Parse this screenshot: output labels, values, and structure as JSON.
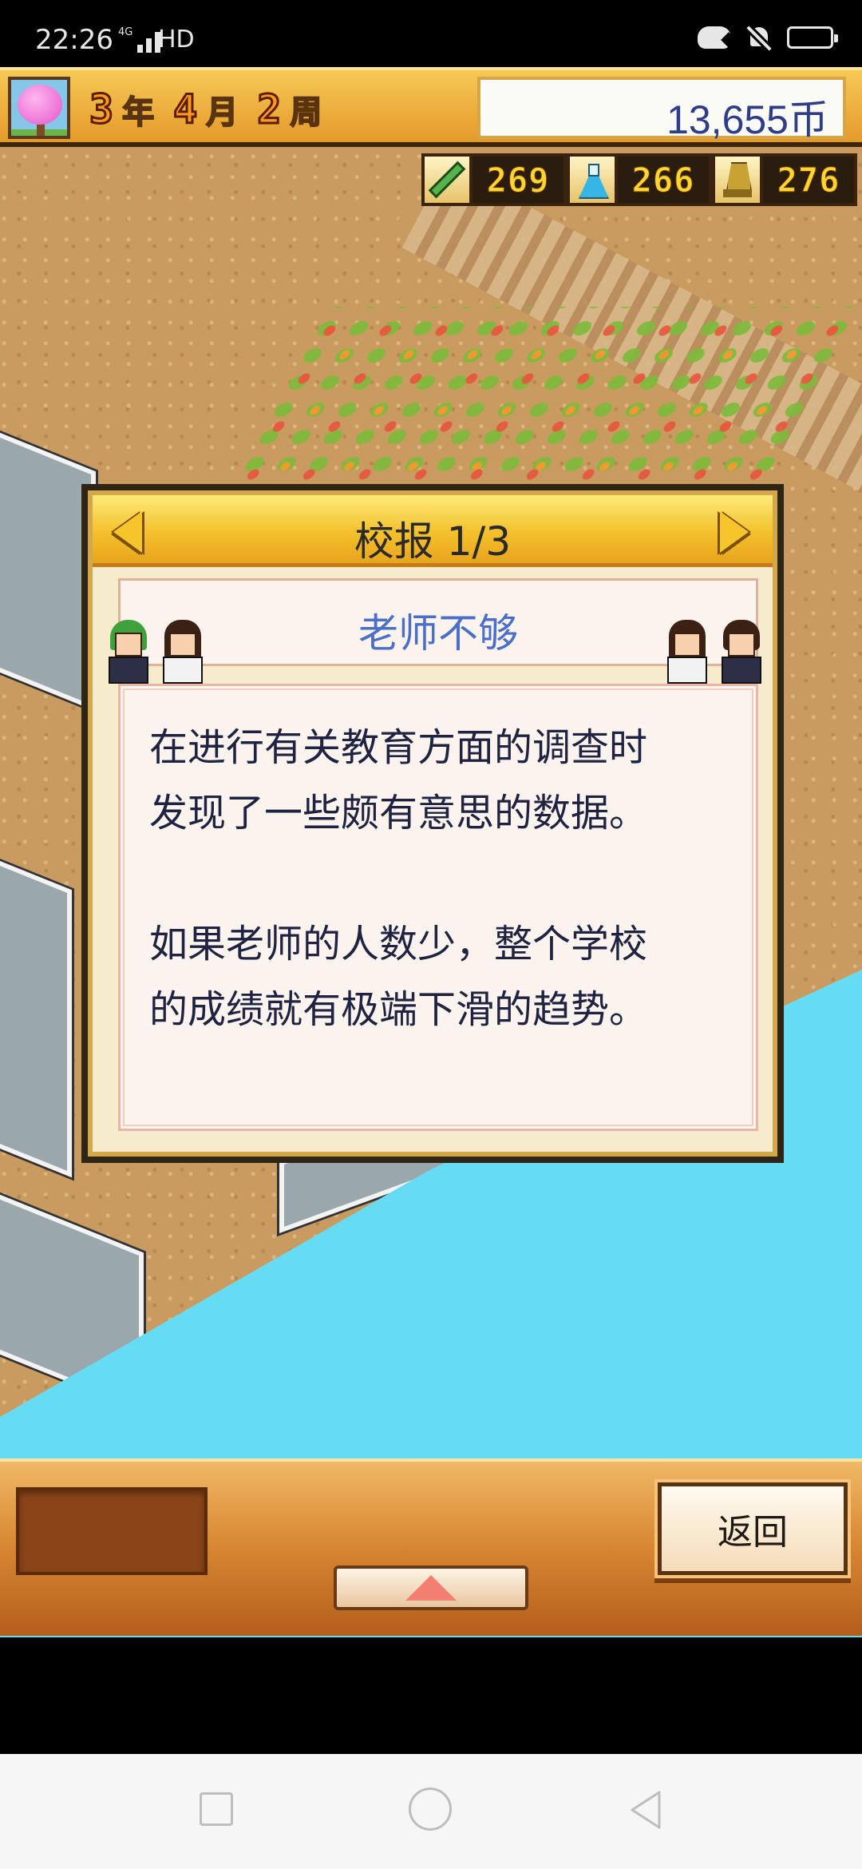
{
  "status_bar": {
    "time": "22:26",
    "network": "4G",
    "hd": "HD",
    "icons": [
      "signal-icon",
      "game-controller-icon",
      "bell-muted-icon",
      "battery-icon"
    ]
  },
  "hud": {
    "year_num": "3",
    "year_unit": "年",
    "month_num": "4",
    "month_unit": "月",
    "week_num": "2",
    "week_unit": "周",
    "money": "13,655币",
    "stats": [
      {
        "icon": "pencil-icon",
        "value": "269"
      },
      {
        "icon": "flask-icon",
        "value": "266"
      },
      {
        "icon": "trophy-icon",
        "value": "276"
      }
    ]
  },
  "dialog": {
    "title": "校报 1/3",
    "headline": "老师不够",
    "body": "在进行有关教育方面的调查时\n发现了一些颇有意思的数据。\n\n如果老师的人数少，整个学校\n的成绩就有极端下滑的趋势。"
  },
  "panel": {
    "back_label": "返回"
  },
  "colors": {
    "hud_gold": "#f4c02c",
    "headline_blue": "#4b6fc6",
    "water": "#66dcf4",
    "dirt": "#c99b61",
    "money_text": "#2f3d88"
  }
}
